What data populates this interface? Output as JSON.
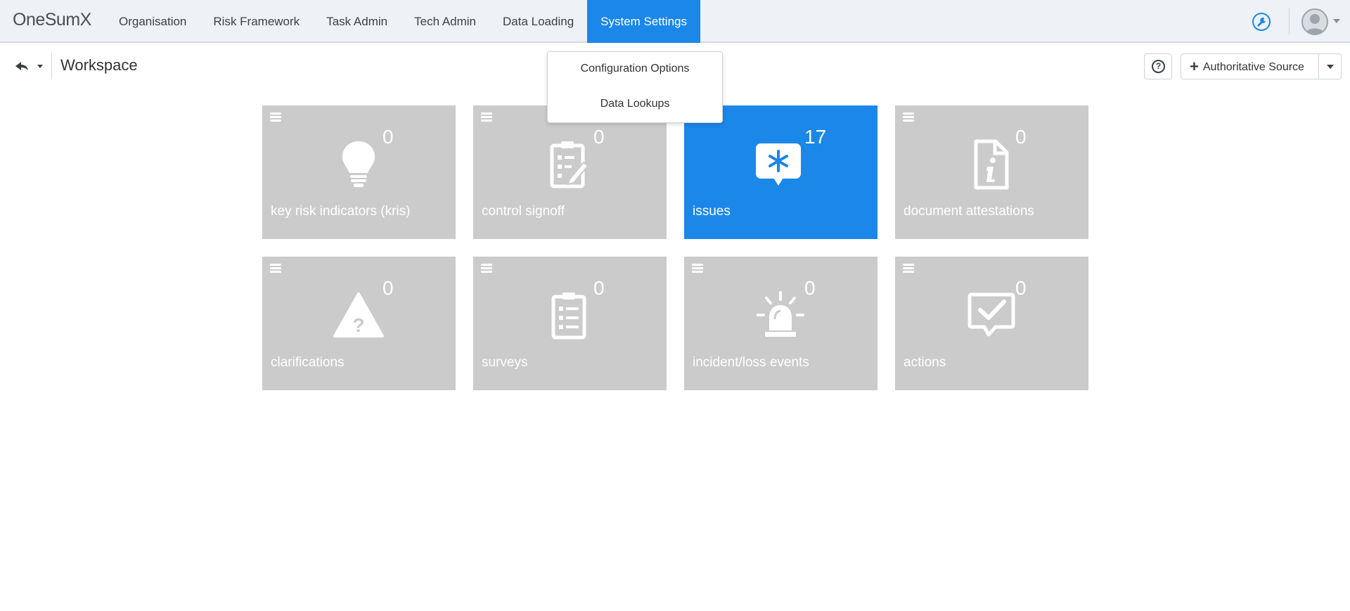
{
  "app": {
    "logo": "OneSumX"
  },
  "nav": {
    "items": [
      "Organisation",
      "Risk Framework",
      "Task Admin",
      "Tech Admin",
      "Data Loading",
      "System Settings"
    ],
    "active": "System Settings"
  },
  "header": {
    "title": "Workspace",
    "help_label": "?",
    "add_source_label": "Authoritative Source"
  },
  "dropdown": {
    "items": [
      "Configuration Options",
      "Data Lookups"
    ]
  },
  "tiles": [
    {
      "label": "key risk indicators (kris)",
      "count": "0",
      "icon": "lightbulb-icon",
      "active": false
    },
    {
      "label": "control signoff",
      "count": "0",
      "icon": "clipboard-edit-icon",
      "active": false
    },
    {
      "label": "issues",
      "count": "17",
      "icon": "asterisk-speech-bubble-icon",
      "active": true
    },
    {
      "label": "document attestations",
      "count": "0",
      "icon": "document-info-icon",
      "active": false
    },
    {
      "label": "clarifications",
      "count": "0",
      "icon": "warning-question-icon",
      "active": false
    },
    {
      "label": "surveys",
      "count": "0",
      "icon": "clipboard-list-icon",
      "active": false
    },
    {
      "label": "incident/loss events",
      "count": "0",
      "icon": "alarm-siren-icon",
      "active": false
    },
    {
      "label": "actions",
      "count": "0",
      "icon": "checkmark-bubble-icon",
      "active": false
    }
  ],
  "colors": {
    "accent": "#1b87e9",
    "tile_inactive": "#cbcbcb",
    "topbar_bg": "#eef1f5"
  }
}
